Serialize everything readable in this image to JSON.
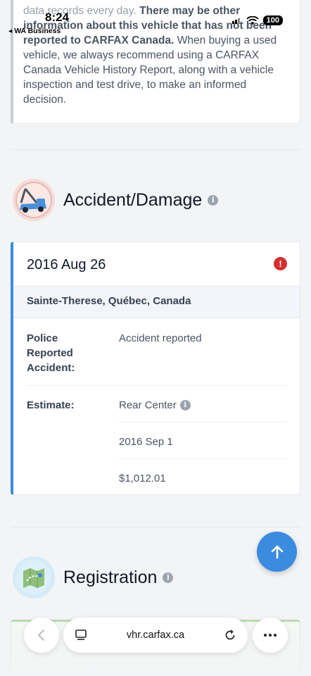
{
  "status_bar": {
    "time": "8:24",
    "back_app": "◂ WA Business",
    "battery": "100"
  },
  "disclaimer": {
    "line1": "data records every day.",
    "bold1": "There may be other information about this vehicle that has not been reported to CARFAX Canada.",
    "rest": "When buying a used vehicle, we always recommend using a CARFAX Canada Vehicle History Report, along with a vehicle inspection and test drive, to make an informed decision."
  },
  "accident_section": {
    "title": "Accident/Damage",
    "record": {
      "date": "2016 Aug 26",
      "location": "Sainte-Therese, Québec, Canada",
      "police_label": "Police Reported Accident:",
      "police_value": "Accident reported",
      "estimate_label": "Estimate:",
      "estimate_area": "Rear Center",
      "estimate_date": "2016 Sep 1",
      "estimate_amount": "$1,012.01"
    }
  },
  "registration_section": {
    "title": "Registration"
  },
  "browser": {
    "url": "vhr.carfax.ca"
  },
  "icons": {
    "accident": "tow-truck-icon",
    "registration": "map-icon",
    "info": "info-icon",
    "alert": "alert-icon",
    "scroll_top": "arrow-up-icon",
    "back": "chevron-left-icon",
    "tabs": "tabs-icon",
    "reload": "reload-icon",
    "more": "more-icon"
  },
  "colors": {
    "accent": "#3b8be0",
    "alert": "#d32f2f"
  }
}
